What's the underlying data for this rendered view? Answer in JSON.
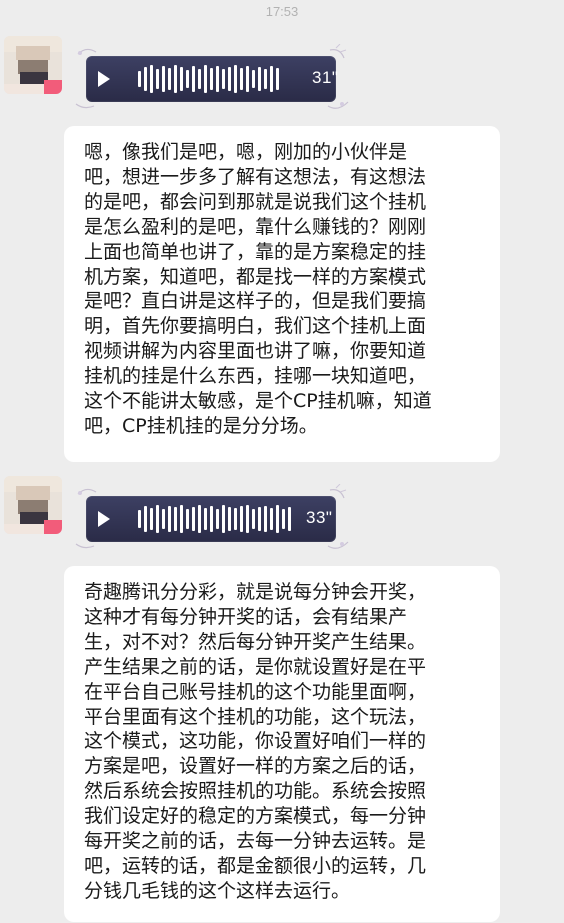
{
  "status": {
    "time": "17:53"
  },
  "messages": [
    {
      "voice": {
        "duration": "31\""
      },
      "transcript": "嗯，像我们是吧，嗯，刚加的小伙伴是\n吧，想进一步多了解有这想法，有这想法\n的是吧，都会问到那就是说我们这个挂机\n是怎么盈利的是吧，靠什么赚钱的？刚刚\n上面也简单也讲了，靠的是方案稳定的挂\n机方案，知道吧，都是找一样的方案模式\n是吧？直白讲是这样子的，但是我们要搞\n明，首先你要搞明白，我们这个挂机上面\n视频讲解为内容里面也讲了嘛，你要知道\n挂机的挂是什么东西，挂哪一块知道吧，\n这个不能讲太敏感，是个CP挂机嘛，知道\n吧，CP挂机挂的是分分场。"
    },
    {
      "voice": {
        "duration": "33\""
      },
      "transcript": "奇趣腾讯分分彩，就是说每分钟会开奖，\n这种才有每分钟开奖的话，会有结果产\n生，对不对？然后每分钟开奖产生结果。\n产生结果之前的话，是你就设置好是在平\n在平台自己账号挂机的这个功能里面啊，\n平台里面有这个挂机的功能，这个玩法，\n这个模式，这功能，你设置好咱们一样的\n方案是吧，设置好一样的方案之后的话，\n然后系统会按照挂机的功能。系统会按照\n我们设定好的稳定的方案模式，每一分钟\n每开奖之前的话，去每一分钟去运转。是\n吧，运转的话，都是金额很小的运转，几\n分钱几毛钱的这个这样去运行。"
    }
  ],
  "icons": {
    "play": "play-icon",
    "waveform": "waveform-icon",
    "avatar": "avatar-blurred"
  },
  "colors": {
    "background": "#ededed",
    "bubble": "#ffffff",
    "voice_bg": "#2f3150",
    "timestamp": "#b2b2b2"
  }
}
